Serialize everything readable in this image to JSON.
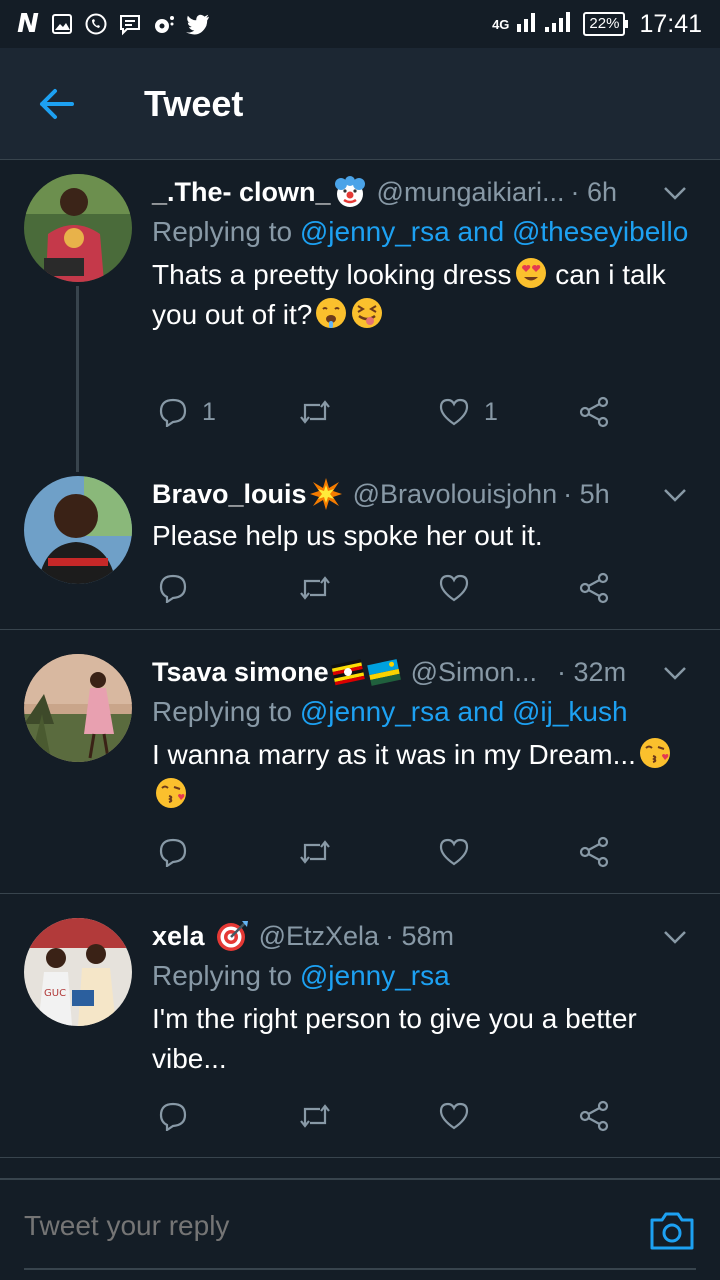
{
  "status_bar": {
    "network": "4G",
    "battery": "22%",
    "time": "17:41"
  },
  "header": {
    "title": "Tweet",
    "back_icon": "arrow-left-icon"
  },
  "colors": {
    "background": "#141d26",
    "header_bg": "#1c2733",
    "accent": "#1da1f2",
    "muted": "#8899a6",
    "divider": "#38444d"
  },
  "tweets": [
    {
      "name": "_.The- clown_",
      "handle": "@mungaikiari...",
      "time": "· 6h",
      "reply_prefix": "Replying to",
      "reply_mentions": "@jenny_rsa and @theseyibello",
      "text": "Thats a preetty looking dress",
      "text2": " can i talk you out of it?",
      "reply_count": "1",
      "like_count": "1"
    },
    {
      "name": "Bravo_louis",
      "handle": "@Bravolouisjohn",
      "time": "· 5h",
      "text": "Please help us spoke her out it."
    },
    {
      "name": "Tsava simone",
      "handle": "@Simon...",
      "time": "· 32m",
      "reply_prefix": "Replying to",
      "reply_mentions": "@jenny_rsa and @ij_kush",
      "text": "I wanna marry as it was in my Dream..."
    },
    {
      "name": "xela",
      "handle": "@EtzXela",
      "time": "· 58m",
      "reply_prefix": "Replying to",
      "reply_mentions": "@jenny_rsa",
      "text": "I'm the right person to give you a better vibe..."
    }
  ],
  "reply_bar": {
    "placeholder": "Tweet your reply",
    "camera_icon": "camera-icon"
  }
}
